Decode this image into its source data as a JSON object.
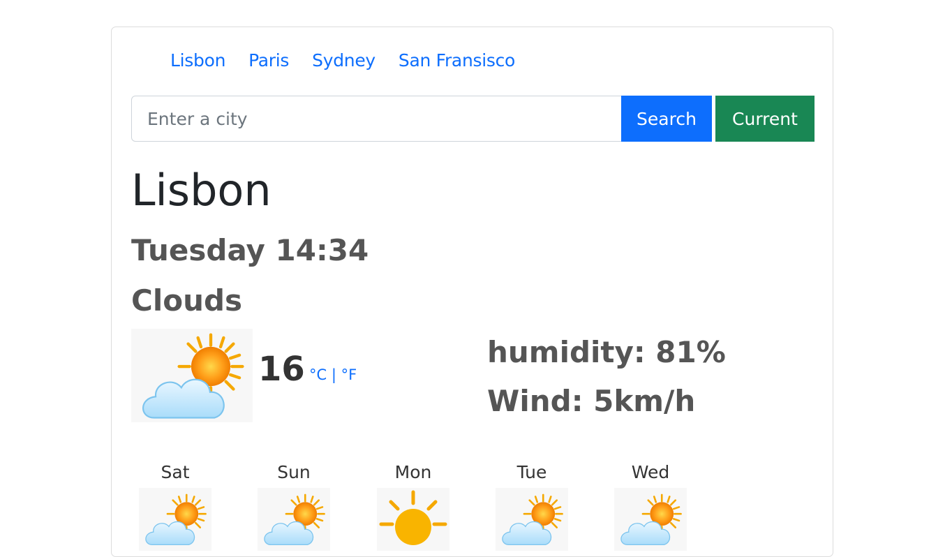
{
  "nav": {
    "cities": [
      "Lisbon",
      "Paris",
      "Sydney",
      "San Fransisco"
    ]
  },
  "search": {
    "placeholder": "Enter a city",
    "value": "",
    "search_label": "Search",
    "current_label": "Current"
  },
  "weather": {
    "city": "Lisbon",
    "datetime": "Tuesday 14:34",
    "description": "Clouds",
    "icon": "partly-cloudy-icon",
    "temperature": "16",
    "unit_celsius": "°C",
    "unit_separator": "|",
    "unit_fahrenheit": "°F",
    "humidity": "humidity: 81%",
    "wind": "Wind: 5km/h"
  },
  "forecast": [
    {
      "day": "Sat",
      "icon": "partly-cloudy-icon"
    },
    {
      "day": "Sun",
      "icon": "partly-cloudy-icon"
    },
    {
      "day": "Mon",
      "icon": "sun-icon"
    },
    {
      "day": "Tue",
      "icon": "partly-cloudy-icon"
    },
    {
      "day": "Wed",
      "icon": "partly-cloudy-icon"
    }
  ],
  "colors": {
    "link": "#0d6efd",
    "search_button": "#0d6efd",
    "current_button": "#198754",
    "sun": "#f5a800",
    "cloud": "#bfe3fb"
  }
}
